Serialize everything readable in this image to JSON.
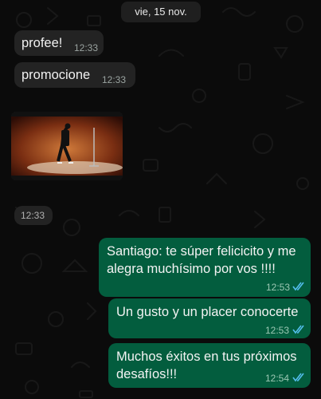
{
  "date_separator": "vie, 15 nov.",
  "incoming": [
    {
      "text": "profee!",
      "time": "12:33"
    },
    {
      "text": "promocione",
      "time": "12:33"
    }
  ],
  "media": {
    "time": "12:33"
  },
  "outgoing": [
    {
      "line1": "Santiago: te súper felicicito y me",
      "line2": "alegra muchísimo por vos !!!!",
      "time": "12:53"
    },
    {
      "line1": "Un gusto y un placer conocerte",
      "time": "12:53"
    },
    {
      "line1": "Muchos éxitos en tus próximos",
      "line2": "desafíos!!!",
      "time": "12:54"
    }
  ],
  "colors": {
    "background": "#0b0b0b",
    "incoming_bubble": "#232323",
    "outgoing_bubble": "#035d3e",
    "read_ticks": "#53bdeb"
  },
  "icons": [
    "double-check-read-icon"
  ]
}
